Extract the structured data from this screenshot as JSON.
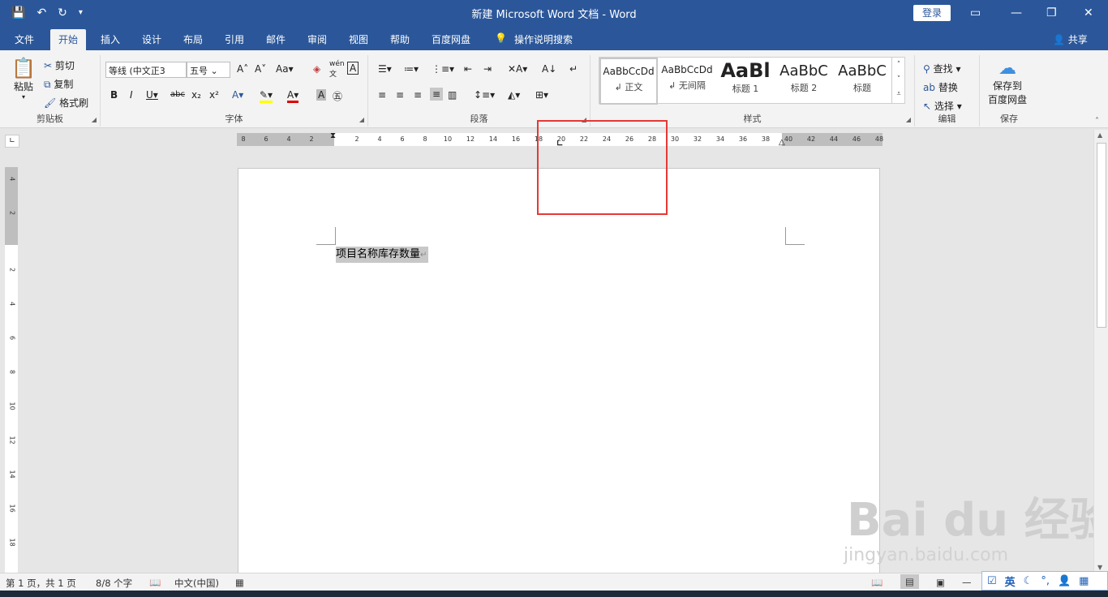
{
  "window": {
    "title": "新建 Microsoft Word 文档  -  Word",
    "login_label": "登录",
    "qat": {
      "save_icon": "save-icon",
      "undo_icon": "undo-icon",
      "redo_icon": "redo-icon",
      "customize_icon": "chevron-down-icon"
    }
  },
  "tabs": [
    "文件",
    "开始",
    "插入",
    "设计",
    "布局",
    "引用",
    "邮件",
    "审阅",
    "视图",
    "帮助",
    "百度网盘",
    "操作说明搜索"
  ],
  "active_tab": "开始",
  "share_label": "共享",
  "ribbon": {
    "clipboard": {
      "label": "剪贴板",
      "paste": "粘贴",
      "cut": "剪切",
      "copy": "复制",
      "format_painter": "格式刷"
    },
    "font": {
      "label": "字体",
      "font_name": "等线 (中文正文)",
      "font_size": "五号",
      "font_name_display": "等线 (中文正3",
      "change_case": "Aa",
      "wen": "wén",
      "bold": "B",
      "italic": "I",
      "underline": "U",
      "strike": "abc",
      "sub": "x₂",
      "sup": "x²"
    },
    "paragraph": {
      "label": "段落"
    },
    "styles": {
      "label": "样式",
      "items": [
        {
          "preview": "AaBbCcDd",
          "name": "正文"
        },
        {
          "preview": "AaBbCcDd",
          "name": "无间隔"
        },
        {
          "preview": "AaBl",
          "name": "标题 1"
        },
        {
          "preview": "AaBbC",
          "name": "标题 2"
        },
        {
          "preview": "AaBbC",
          "name": "标题"
        }
      ]
    },
    "editing": {
      "label": "编辑",
      "find": "查找",
      "replace": "替换",
      "select": "选择"
    },
    "save": {
      "label": "保存",
      "button_line1": "保存到",
      "button_line2": "百度网盘"
    }
  },
  "ruler": {
    "h_ticks": [
      "8",
      "6",
      "4",
      "2",
      "2",
      "4",
      "6",
      "8",
      "10",
      "12",
      "14",
      "16",
      "18",
      "20",
      "22",
      "24",
      "26",
      "28",
      "30",
      "32",
      "34",
      "36",
      "38",
      "40",
      "42",
      "44",
      "46",
      "48"
    ],
    "v_ticks": [
      "4",
      "2",
      "2",
      "4",
      "6",
      "8",
      "10",
      "12",
      "14",
      "16",
      "18"
    ]
  },
  "document": {
    "text": "项目名称库存数量"
  },
  "status": {
    "page": "第 1 页，共 1 页",
    "words": "8/8 个字",
    "language": "中文(中国)"
  },
  "ime": {
    "mode": "英"
  },
  "watermark": {
    "line1": "Bai du 经验",
    "line2": "jingyan.baidu.com"
  }
}
